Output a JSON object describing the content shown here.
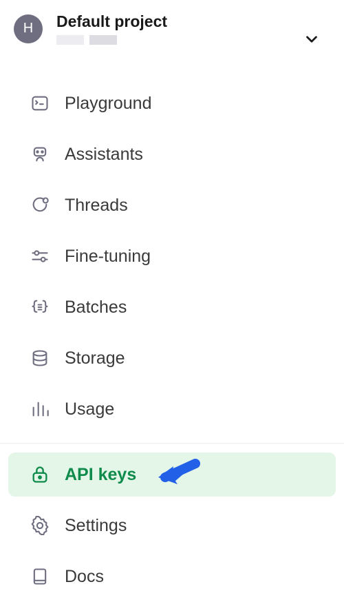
{
  "header": {
    "avatar_initial": "H",
    "project_name": "Default project"
  },
  "nav": {
    "items": [
      {
        "key": "playground",
        "label": "Playground"
      },
      {
        "key": "assistants",
        "label": "Assistants"
      },
      {
        "key": "threads",
        "label": "Threads"
      },
      {
        "key": "fine-tuning",
        "label": "Fine-tuning"
      },
      {
        "key": "batches",
        "label": "Batches"
      },
      {
        "key": "storage",
        "label": "Storage"
      },
      {
        "key": "usage",
        "label": "Usage"
      },
      {
        "key": "api-keys",
        "label": "API keys"
      },
      {
        "key": "settings",
        "label": "Settings"
      },
      {
        "key": "docs",
        "label": "Docs"
      }
    ],
    "active_key": "api-keys"
  },
  "colors": {
    "accent": "#0f8b4c",
    "active_bg": "#e3f6e8",
    "icon": "#6e6e80",
    "arrow": "#2360e8"
  }
}
